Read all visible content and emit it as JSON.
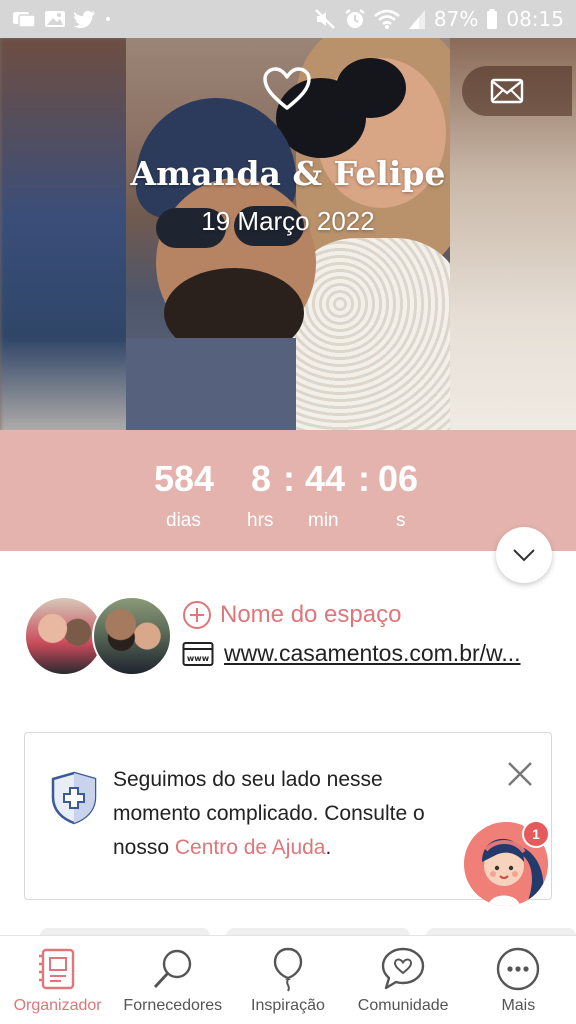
{
  "status_bar": {
    "battery": "87%",
    "time": "08:15",
    "icons": [
      "messages-icon",
      "gallery-icon",
      "twitter-icon",
      "dot-icon",
      "mute-icon",
      "alarm-icon",
      "wifi-icon",
      "signal-icon",
      "battery-icon"
    ]
  },
  "hero": {
    "couple_name": "Amanda & Felipe",
    "date": "19 Março 2022"
  },
  "countdown": {
    "days": "584",
    "days_label": "dias",
    "hours": "8",
    "hours_label": "hrs",
    "minutes": "44",
    "minutes_label": "min",
    "seconds": "06",
    "seconds_label": "s",
    "separator": ":"
  },
  "info": {
    "venue_label": "Nome do espaço",
    "website": "www.casamentos.com.br/w..."
  },
  "notice": {
    "text_before": "Seguimos do seu lado nesse momento complicado. Consulte o nosso ",
    "link": "Centro de Ajuda",
    "text_after": "."
  },
  "assistant": {
    "badge": "1"
  },
  "nav": {
    "items": [
      {
        "label": "Organizador",
        "icon": "planner-icon",
        "active": true
      },
      {
        "label": "Fornecedores",
        "icon": "search-icon",
        "active": false
      },
      {
        "label": "Inspiração",
        "icon": "balloon-icon",
        "active": false
      },
      {
        "label": "Comunidade",
        "icon": "chat-heart-icon",
        "active": false
      },
      {
        "label": "Mais",
        "icon": "more-icon",
        "active": false
      }
    ]
  },
  "colors": {
    "accent": "#e0767a",
    "countdown_bg": "#e5b3ad",
    "status_bar_bg": "#d6d6d6"
  }
}
